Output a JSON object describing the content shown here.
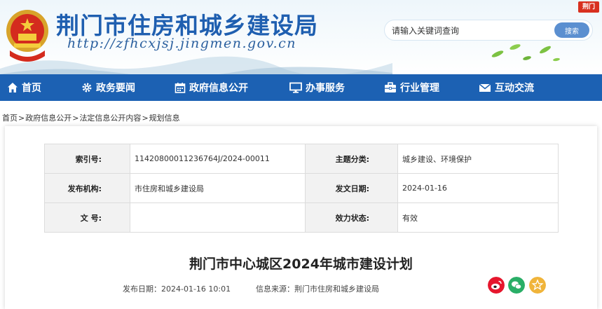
{
  "header": {
    "site_title": "荆门市住房和城乡建设局",
    "site_url": "http://zfhcxjsj.jingmen.gov.cn",
    "search_placeholder": "请输入关键词查询",
    "search_button": "搜索",
    "corner_badge": "荆门"
  },
  "nav": {
    "items": [
      {
        "label": "首页",
        "icon": "home-icon"
      },
      {
        "label": "政务要闻",
        "icon": "gear-icon"
      },
      {
        "label": "政府信息公开",
        "icon": "calendar-icon"
      },
      {
        "label": "办事服务",
        "icon": "monitor-icon"
      },
      {
        "label": "行业管理",
        "icon": "briefcase-icon"
      },
      {
        "label": "互动交流",
        "icon": "mail-icon"
      }
    ]
  },
  "breadcrumb": {
    "items": [
      "首页",
      "政府信息公开",
      "法定信息公开内容",
      "规划信息"
    ],
    "separator": ">"
  },
  "meta": {
    "index_label": "索引号:",
    "index_value": "114208000112367​64J/2024-00011",
    "category_label": "主题分类:",
    "category_value": "城乡建设、环境保护",
    "agency_label": "发布机构:",
    "agency_value": "市住房和城乡建设局",
    "date_label": "发文日期:",
    "date_value": "2024-01-16",
    "docno_label": "文 号:",
    "docno_value": "",
    "status_label": "效力状态:",
    "status_value": "有效"
  },
  "article": {
    "title": "荆门市中心城区2024年城市建设计划",
    "publish_date": "发布日期：2024-01-16 10:01",
    "source": "信息来源：荆门市住房和城乡建设局"
  },
  "share": [
    {
      "icon": "weibo-icon",
      "color": "#e6162d"
    },
    {
      "icon": "wechat-icon",
      "color": "#2aae67"
    },
    {
      "icon": "star-icon",
      "color": "#f0b43a"
    }
  ],
  "colors": {
    "nav_bg": "#1c61b3",
    "title_blue": "#1f5fb0",
    "search_btn": "#5b8fd0"
  }
}
